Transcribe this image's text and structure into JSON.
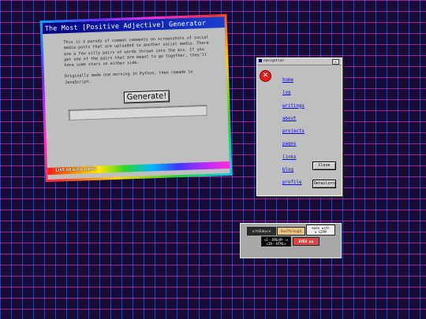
{
  "generator": {
    "title": "The Most [Positive Adjective] Generator",
    "description": "This is a parody of common comments on screenshots of social media posts that are uploaded to another social media. There are a few silly pairs of words thrown into the mix. If you get one of the pairs that are meant to go together, they'll have some stars on either side.",
    "origin": "Originally made one morning in Python, then remade in JavaScript.",
    "generate_label": "Generate!",
    "output_value": "",
    "silly_pairs_link": "List of silly pairs"
  },
  "nav_window": {
    "title": "navigation",
    "links": [
      "home",
      "log",
      "writings",
      "about",
      "projects",
      "pages",
      "links",
      "blog",
      "profile"
    ],
    "close_label": "Close",
    "details_label": "Details>>"
  },
  "badges": {
    "b1": "arhOUmare",
    "b2": "SeeThrough",
    "b3a": "made with",
    "b3b": "a GIMP",
    "b4a": "<I--DREAM-->",
    "b4b": "<IN--HTML>",
    "b5": "EYES"
  },
  "colors": {
    "grid_pink": "#ff3cdc",
    "grid_blue": "#3c78ff",
    "background": "#1a0a36",
    "title_bar": "#000080",
    "link": "#0000ee"
  }
}
